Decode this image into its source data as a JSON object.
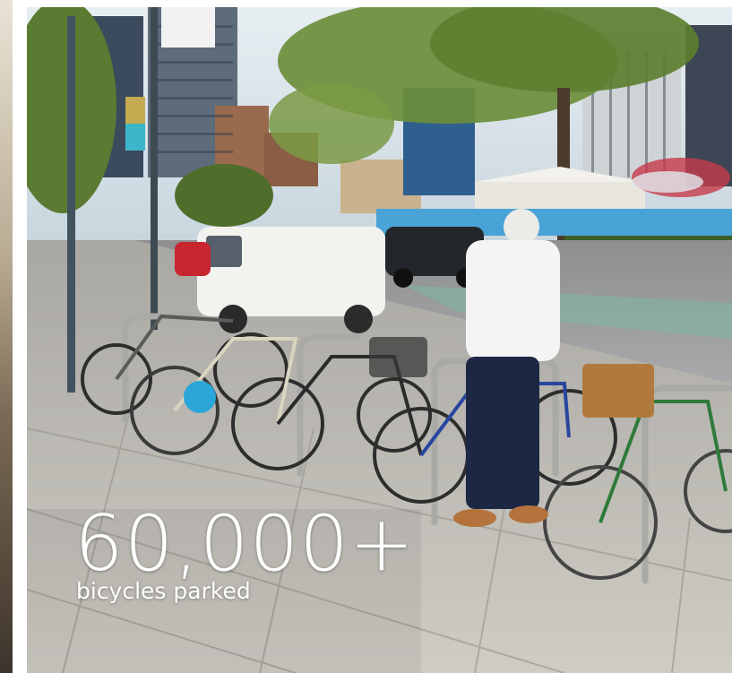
{
  "stat": {
    "value": "60,000+",
    "label": "bicycles parked"
  },
  "colors": {
    "caption_text": "#ffffff",
    "sky": "#dfe9ef",
    "pavement": "#bdbab3",
    "grass": "#6f9a3a",
    "barrier": "#4aa3d6"
  }
}
